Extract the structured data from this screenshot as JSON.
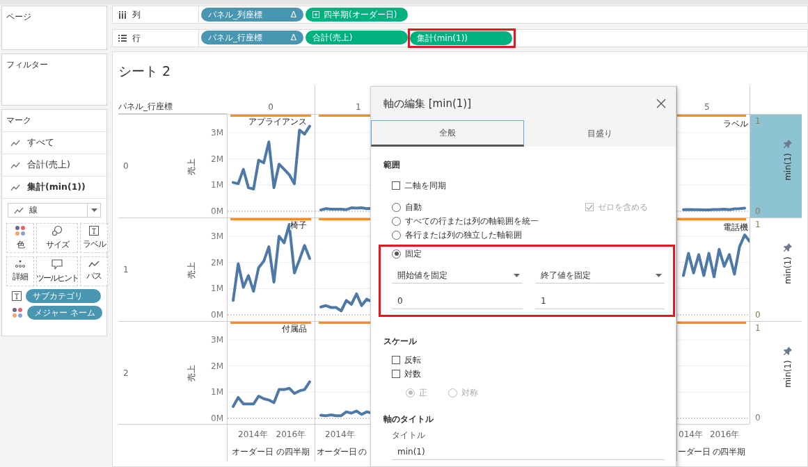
{
  "left_panel": {
    "pages_title": "ページ",
    "filters_title": "フィルター",
    "marks": {
      "title": "マーク",
      "cards": [
        {
          "label": "すべて",
          "selected": false
        },
        {
          "label": "合計(売上)",
          "selected": false
        },
        {
          "label": "集計(min(1))",
          "selected": true
        }
      ],
      "mark_type": "線",
      "buttons": [
        {
          "kind": "color",
          "label": "色"
        },
        {
          "kind": "size",
          "label": "サイズ"
        },
        {
          "kind": "label",
          "label": "ラベル"
        },
        {
          "kind": "detail",
          "label": "詳細"
        },
        {
          "kind": "tooltip",
          "label": "ツールヒント"
        },
        {
          "kind": "path",
          "label": "パス"
        }
      ],
      "fields": [
        {
          "kind": "label",
          "name": "サブカテゴリ"
        },
        {
          "kind": "color",
          "name": "メジャー ネーム"
        }
      ]
    }
  },
  "shelves": [
    {
      "kind": "columns",
      "label": "列",
      "pills": [
        {
          "kind": "dimension",
          "text": "パネル_列座標",
          "suffix": "Δ",
          "expandable": false,
          "highlighted": false
        },
        {
          "kind": "measure",
          "text": "四半期(オーダー日)",
          "expandable": true,
          "highlighted": false
        }
      ]
    },
    {
      "kind": "rows",
      "label": "行",
      "pills": [
        {
          "kind": "dimension",
          "text": "パネル_行座標",
          "suffix": "Δ",
          "expandable": false,
          "highlighted": false
        },
        {
          "kind": "measure",
          "text": "合計(売上)",
          "expandable": false,
          "highlighted": false
        },
        {
          "kind": "measure",
          "text": "集計(min(1))",
          "expandable": false,
          "highlighted": true
        }
      ]
    }
  ],
  "sheet": {
    "title": "シート 2",
    "row_header_title": "パネル_行座標",
    "columns": [
      {
        "header": "0",
        "x_ticks": [
          "2014年",
          "2016年"
        ],
        "x_title": "オーダー日 の四半期"
      },
      {
        "header": "1",
        "x_ticks": [
          "2014年"
        ],
        "x_title": "オーダー日 の"
      },
      {
        "header": "5",
        "x_ticks": [
          "014年",
          "2016年"
        ],
        "x_title": "ーダー日 の四半期"
      }
    ],
    "rows": [
      {
        "header": "0",
        "y_title": "売上",
        "right_axis": {
          "title": "min(1)",
          "ticks": [
            "1",
            "0"
          ],
          "selected": true
        },
        "panels": [
          {
            "kind": "left",
            "label": "アプライアンス",
            "chart_data": {
              "type": "line",
              "grid": true,
              "categories": [
                null,
                null,
                null,
                null,
                null,
                null,
                null,
                null,
                null,
                null,
                null,
                null,
                null,
                null,
                null,
                null
              ],
              "series": [
                {
                  "color": "#4e79a7",
                  "values": [
                    1.1,
                    1.05,
                    1.6,
                    0.9,
                    0.85,
                    1.95,
                    1.85,
                    2.65,
                    0.9,
                    1.8,
                    1.6,
                    1.4,
                    1.05,
                    3.1,
                    2.95,
                    3.25
                  ]
                }
              ],
              "ylim": [
                0,
                3.69
              ],
              "yticks": [
                {
                  "value": 3,
                  "label": "3M"
                },
                {
                  "value": 2,
                  "label": "2M"
                },
                {
                  "value": 1,
                  "label": "1M"
                },
                {
                  "value": 0,
                  "label": "0M"
                }
              ]
            }
          },
          {
            "kind": "middle"
          },
          {
            "kind": "right",
            "label": "ラベル"
          }
        ]
      },
      {
        "header": "1",
        "y_title": "売上",
        "right_axis": {
          "title": "min(1)",
          "ticks": [
            "1",
            "0"
          ],
          "selected": false
        },
        "panels": [
          {
            "kind": "left",
            "label": "椅子",
            "chart_data": {
              "type": "line",
              "grid": true,
              "categories": [
                null,
                null,
                null,
                null,
                null,
                null,
                null,
                null,
                null,
                null,
                null,
                null,
                null,
                null,
                null,
                null
              ],
              "series": [
                {
                  "color": "#4e79a7",
                  "values": [
                    0.55,
                    1.95,
                    1.05,
                    1.5,
                    0.9,
                    1.8,
                    2.05,
                    2.6,
                    1.25,
                    3.0,
                    2.75,
                    3.45,
                    1.6,
                    2.1,
                    2.65,
                    2.15
                  ]
                }
              ],
              "ylim": [
                0,
                3.69
              ],
              "yticks": [
                {
                  "value": 3,
                  "label": "3M"
                },
                {
                  "value": 2,
                  "label": "2M"
                },
                {
                  "value": 1,
                  "label": "1M"
                },
                {
                  "value": 0,
                  "label": "0M"
                }
              ]
            }
          },
          {
            "kind": "middle"
          },
          {
            "kind": "right",
            "label": "電話機"
          }
        ]
      },
      {
        "header": "2",
        "y_title": "売上",
        "right_axis": {
          "title": "min(1)",
          "ticks": [
            "1",
            "0"
          ],
          "selected": false
        },
        "panels": [
          {
            "kind": "left",
            "label": "付属品",
            "chart_data": {
              "type": "line",
              "grid": true,
              "categories": [
                null,
                null,
                null,
                null,
                null,
                null,
                null,
                null,
                null,
                null,
                null,
                null,
                null,
                null,
                null,
                null
              ],
              "series": [
                {
                  "color": "#4e79a7",
                  "values": [
                    0.45,
                    0.8,
                    0.55,
                    0.55,
                    0.55,
                    0.85,
                    0.75,
                    0.7,
                    0.6,
                    1.1,
                    1.1,
                    1.15,
                    0.95,
                    1.05,
                    1.1,
                    1.4
                  ]
                }
              ],
              "ylim": [
                0,
                3.69
              ],
              "yticks": [
                {
                  "value": 3,
                  "label": "3M"
                },
                {
                  "value": 2,
                  "label": "2M"
                },
                {
                  "value": 1,
                  "label": "1M"
                },
                {
                  "value": 0,
                  "label": "0M"
                }
              ]
            }
          },
          {
            "kind": "middle"
          }
        ]
      }
    ]
  },
  "dialog": {
    "title": "軸の編集 [min(1)]",
    "tabs": [
      {
        "label": "全般",
        "selected": true
      },
      {
        "label": "目盛り",
        "selected": false
      }
    ],
    "range": {
      "heading": "範囲",
      "sync_dual": {
        "label": "二軸を同期",
        "checked": false
      },
      "modes": [
        {
          "kind": "auto",
          "label": "自動",
          "selected": false
        },
        {
          "kind": "uniform",
          "label": "すべての行または列の軸範囲を統一",
          "selected": false
        },
        {
          "kind": "independent",
          "label": "各行または列の独立した軸範囲",
          "selected": false
        },
        {
          "kind": "fixed",
          "label": "固定",
          "selected": true
        }
      ],
      "include_zero": {
        "label": "ゼロを含める",
        "checked": true,
        "disabled": true
      },
      "fixed_highlighted": true,
      "start": {
        "mode": "開始値を固定",
        "value": "0"
      },
      "end": {
        "mode": "終了値を固定",
        "value": "1"
      }
    },
    "scale": {
      "heading": "スケール",
      "options": [
        {
          "label": "反転",
          "checked": false
        },
        {
          "label": "対数",
          "checked": false
        }
      ],
      "log_modes": [
        {
          "label": "正",
          "selected": true,
          "disabled": true
        },
        {
          "label": "対称",
          "selected": false,
          "disabled": true
        }
      ]
    },
    "axis_title": {
      "heading": "軸のタイトル",
      "field_label": "タイトル",
      "value": "min(1)"
    }
  }
}
